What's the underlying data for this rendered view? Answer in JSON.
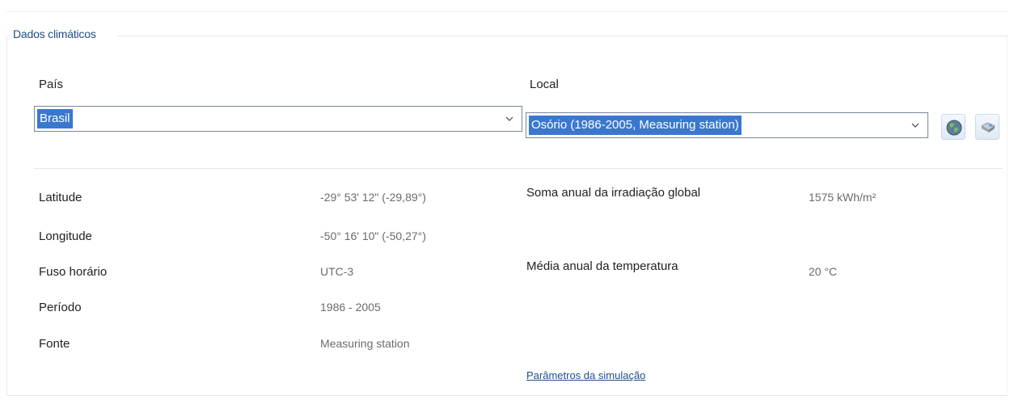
{
  "group": {
    "title": "Dados climáticos"
  },
  "country": {
    "label": "País",
    "value": "Brasil"
  },
  "location": {
    "label": "Local",
    "value": "Osório (1986-2005, Measuring station)"
  },
  "icons": {
    "globe": "globe-icon",
    "map": "map-icon"
  },
  "details": [
    {
      "label": "Latitude",
      "value": "-29° 53' 12\" (-29,89°)"
    },
    {
      "label": "Longitude",
      "value": "-50° 16' 10\" (-50,27°)"
    },
    {
      "label": "Fuso horário",
      "value": "UTC-3"
    },
    {
      "label": "Período",
      "value": "1986 - 2005"
    },
    {
      "label": "Fonte",
      "value": "Measuring station"
    }
  ],
  "annual": [
    {
      "label": "Soma anual da irradiação global",
      "value": "1575 kWh/m²"
    },
    {
      "label": "Média anual da temperatura",
      "value": "20 °C"
    }
  ],
  "link": {
    "label": "Parâmetros da simulação"
  },
  "colors": {
    "accent": "#1e4f86",
    "selection": "#3a78d0"
  }
}
